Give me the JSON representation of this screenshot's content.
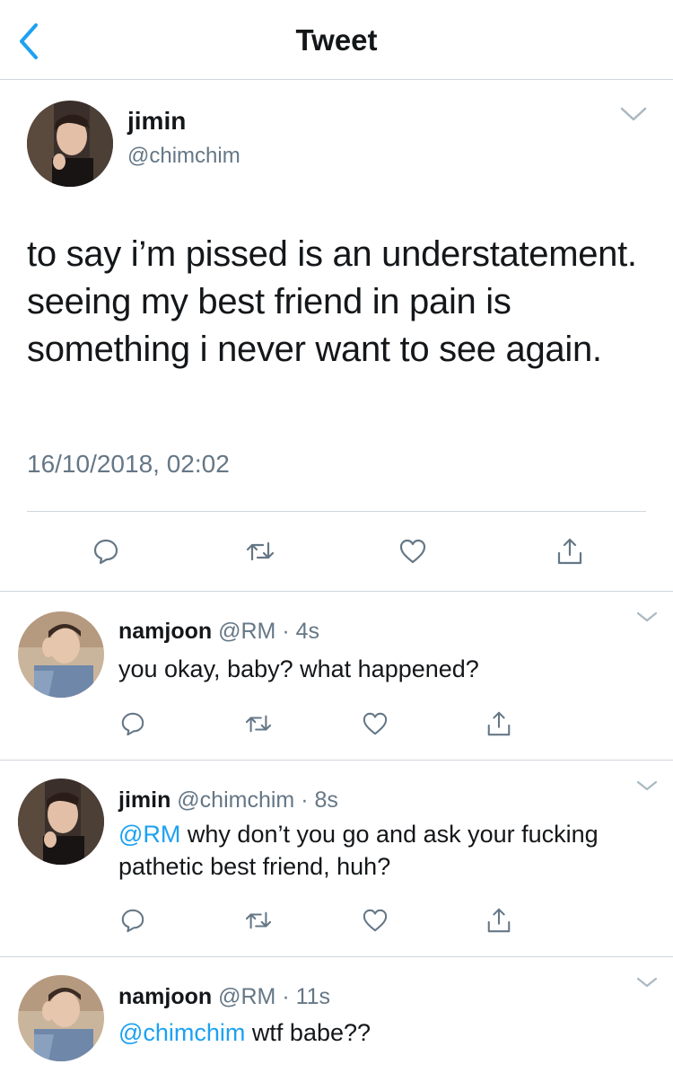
{
  "header": {
    "title": "Tweet",
    "back_icon": "chevron-left-icon"
  },
  "main_tweet": {
    "name": "jimin",
    "handle": "@chimchim",
    "text": "to say i’m pissed is an understatement. seeing my best friend in pain is something i never want to see again.",
    "timestamp": "16/10/2018, 02:02",
    "actions": [
      "reply-icon",
      "retweet-icon",
      "like-icon",
      "share-icon"
    ]
  },
  "replies": [
    {
      "name": "namjoon",
      "meta": "@RM · 4s",
      "mention": "",
      "text": "you okay, baby? what happened?"
    },
    {
      "name": "jimin",
      "meta": "@chimchim · 8s",
      "mention": "@RM",
      "text": " why don’t you go and ask your fucking pathetic best friend, huh?"
    },
    {
      "name": "namjoon",
      "meta": "@RM · 11s",
      "mention": "@chimchim",
      "text": " wtf babe??"
    }
  ],
  "colors": {
    "accent": "#1da1f2",
    "text": "#14171a",
    "secondary": "#657786",
    "border": "#cfd6dc"
  }
}
